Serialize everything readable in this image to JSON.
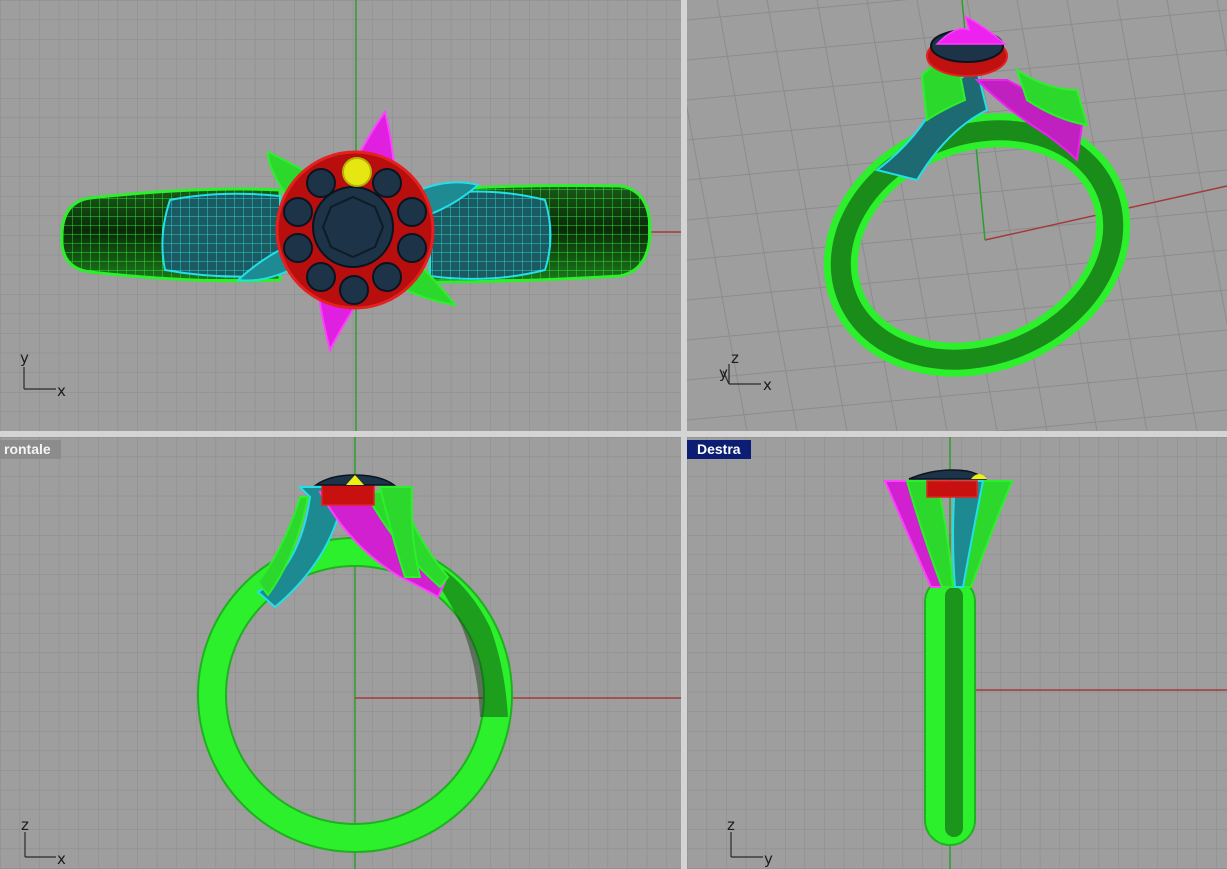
{
  "viewports": {
    "top": {
      "axis_labels": {
        "horizontal": "x",
        "vertical": "y"
      }
    },
    "perspective": {
      "axis_labels": {
        "horizontal": "x",
        "vertical": "z",
        "depth": "y"
      }
    },
    "front": {
      "title": "rontale",
      "active": false,
      "axis_labels": {
        "horizontal": "x",
        "vertical": "z"
      }
    },
    "right": {
      "title": "Destra",
      "active": true,
      "axis_labels": {
        "horizontal": "y",
        "vertical": "z"
      }
    }
  },
  "colors": {
    "viewport_background": "#9e9e9e",
    "grid": "#8a8a8a",
    "x_axis": "#a33a3a",
    "y_axis": "#2e9e2e",
    "shank": "#22ee22",
    "cyan_surface": "#22e0e8",
    "magenta_surface": "#ee22ee",
    "bezel": "#d41010",
    "gemstone": "#1d3347",
    "accent_stone": "#f0f010",
    "active_title": "#0b1e74"
  }
}
